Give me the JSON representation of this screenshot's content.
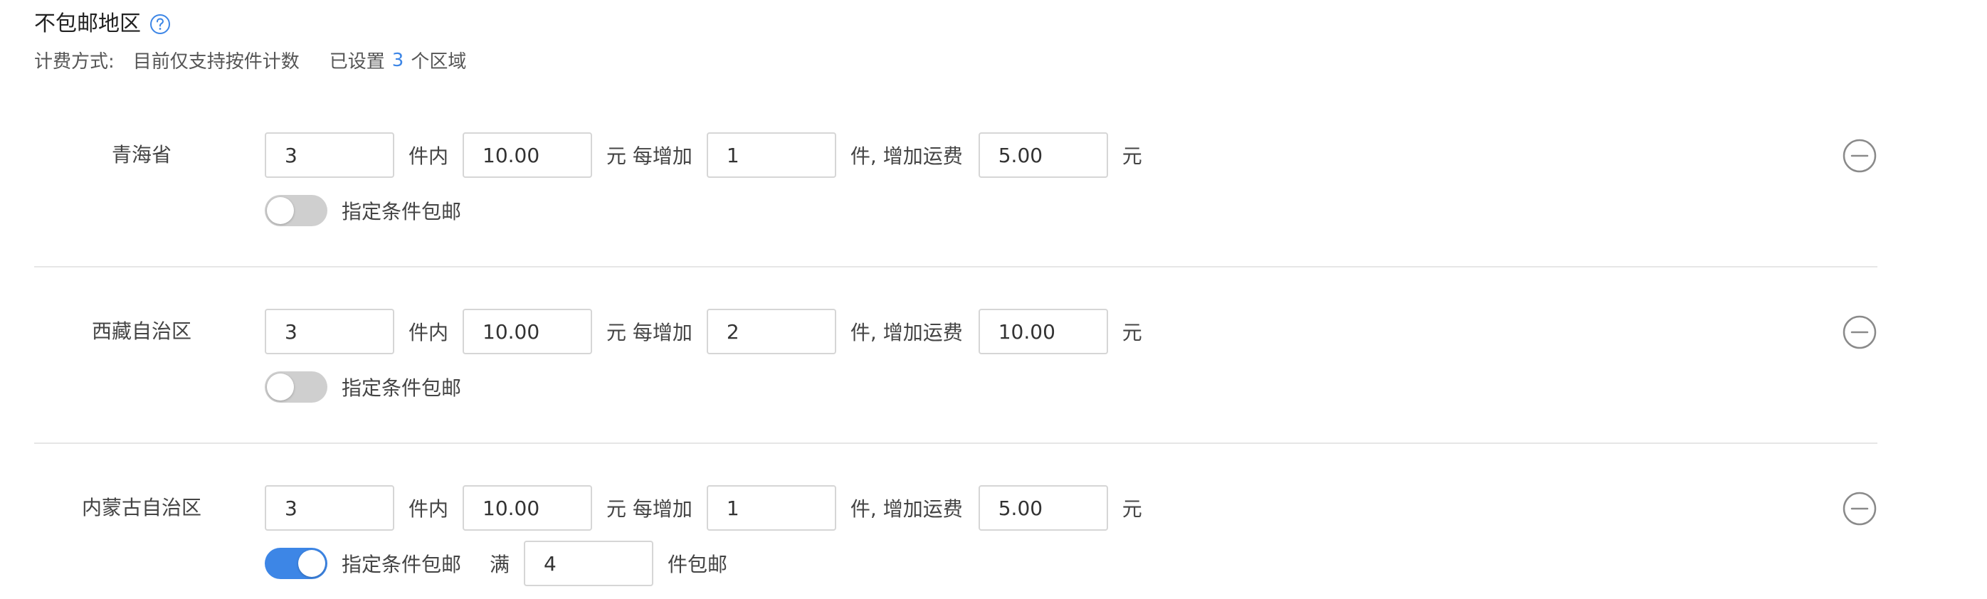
{
  "header": {
    "title": "不包邮地区",
    "help_icon": "question-circle-icon",
    "billing_label": "计费方式:",
    "billing_method": "目前仅支持按件计数",
    "set_prefix": "已设置",
    "set_count": "3",
    "set_suffix": "个区域"
  },
  "colors": {
    "accent": "#3d86e6",
    "toggle_off": "#cfcfcf",
    "divider": "#e6e6e6"
  },
  "units": {
    "within": "件内",
    "yuan_each_add": "元 每增加",
    "jian_add_fee": "件, 增加运费",
    "yuan": "元",
    "conditional_free": "指定条件包邮",
    "man": "满",
    "jian_free": "件包邮"
  },
  "regions": [
    {
      "name": "青海省",
      "first_qty": "3",
      "first_fee": "10.00",
      "add_qty": "1",
      "add_fee": "5.00",
      "conditional_free_enabled": false
    },
    {
      "name": "西藏自治区",
      "first_qty": "3",
      "first_fee": "10.00",
      "add_qty": "2",
      "add_fee": "10.00",
      "conditional_free_enabled": false
    },
    {
      "name": "内蒙古自治区",
      "first_qty": "3",
      "first_fee": "10.00",
      "add_qty": "1",
      "add_fee": "5.00",
      "conditional_free_enabled": true,
      "free_threshold_qty": "4"
    }
  ],
  "remove_icon": "minus-circle-icon"
}
